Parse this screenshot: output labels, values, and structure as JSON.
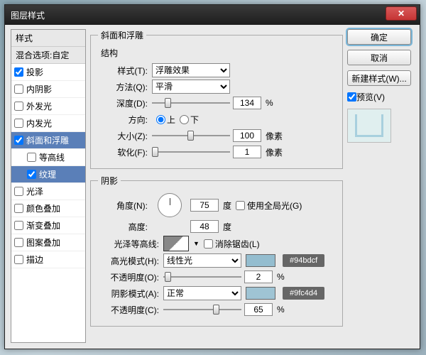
{
  "window": {
    "title": "图层样式"
  },
  "sidebar": {
    "header": "样式",
    "blend": "混合选项:自定",
    "items": [
      {
        "label": "投影",
        "checked": true,
        "indent": false,
        "selected": false
      },
      {
        "label": "内阴影",
        "checked": false,
        "indent": false,
        "selected": false
      },
      {
        "label": "外发光",
        "checked": false,
        "indent": false,
        "selected": false
      },
      {
        "label": "内发光",
        "checked": false,
        "indent": false,
        "selected": false
      },
      {
        "label": "斜面和浮雕",
        "checked": true,
        "indent": false,
        "selected": true
      },
      {
        "label": "等高线",
        "checked": false,
        "indent": true,
        "selected": false
      },
      {
        "label": "纹理",
        "checked": true,
        "indent": true,
        "selected": true
      },
      {
        "label": "光泽",
        "checked": false,
        "indent": false,
        "selected": false
      },
      {
        "label": "颜色叠加",
        "checked": false,
        "indent": false,
        "selected": false
      },
      {
        "label": "渐变叠加",
        "checked": false,
        "indent": false,
        "selected": false
      },
      {
        "label": "图案叠加",
        "checked": false,
        "indent": false,
        "selected": false
      },
      {
        "label": "描边",
        "checked": false,
        "indent": false,
        "selected": false
      }
    ]
  },
  "panel": {
    "title": "斜面和浮雕",
    "structure": {
      "group": "结构",
      "style_lbl": "样式(T):",
      "style_val": "浮雕效果",
      "method_lbl": "方法(Q):",
      "method_val": "平滑",
      "depth_lbl": "深度(D):",
      "depth_val": "134",
      "depth_unit": "%",
      "dir_lbl": "方向:",
      "dir_up": "上",
      "dir_down": "下",
      "size_lbl": "大小(Z):",
      "size_val": "100",
      "size_unit": "像素",
      "soft_lbl": "软化(F):",
      "soft_val": "1",
      "soft_unit": "像素"
    },
    "shadow": {
      "group": "阴影",
      "angle_lbl": "角度(N):",
      "angle_val": "75",
      "angle_unit": "度",
      "global_lbl": "使用全局光(G)",
      "alt_lbl": "高度:",
      "alt_val": "48",
      "alt_unit": "度",
      "gloss_lbl": "光泽等高线:",
      "anti_lbl": "消除锯齿(L)",
      "hmode_lbl": "高光模式(H):",
      "hmode_val": "线性光",
      "hopacity_lbl": "不透明度(O):",
      "hopacity_val": "2",
      "hopacity_unit": "%",
      "smode_lbl": "阴影模式(A):",
      "smode_val": "正常",
      "sopacity_lbl": "不透明度(C):",
      "sopacity_val": "65",
      "sopacity_unit": "%",
      "hcolor": "#94bdcf",
      "scolor": "#9fc4d4",
      "hcolor_tag": "#94bdcf",
      "scolor_tag": "#9fc4d4"
    }
  },
  "buttons": {
    "ok": "确定",
    "cancel": "取消",
    "newstyle": "新建样式(W)...",
    "preview": "预览(V)"
  }
}
